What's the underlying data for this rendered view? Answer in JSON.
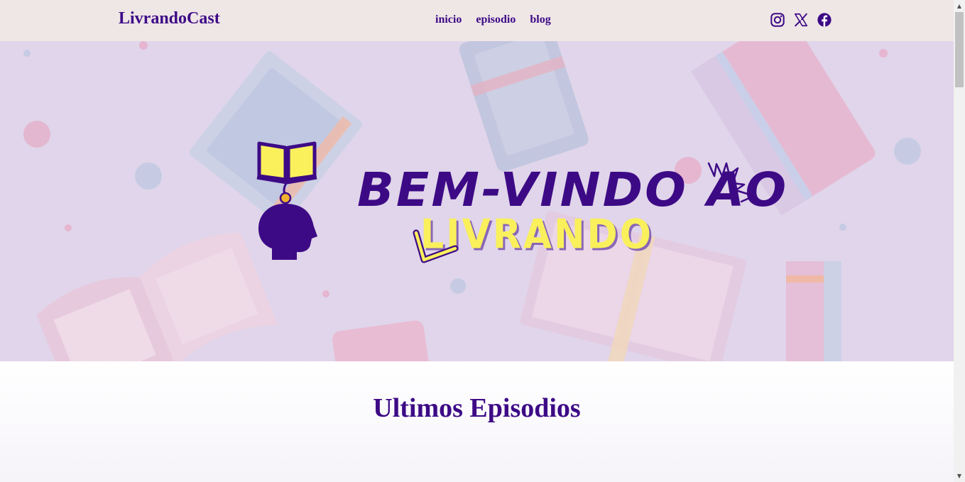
{
  "navbar": {
    "brand": "LivrandoCast",
    "links": [
      "inicio",
      "episodio",
      "blog"
    ],
    "social_icons": [
      "instagram-icon",
      "x-icon",
      "facebook-icon"
    ],
    "background": "#efe6e6"
  },
  "hero": {
    "title": "BEM-VINDO AO",
    "subtitle": "LIVRANDO",
    "background": "#e0d5ea"
  },
  "episodes": {
    "title": "Ultimos Episodios"
  },
  "colors": {
    "brand_purple": "#3d0a86",
    "accent_yellow": "#f9f05c"
  }
}
